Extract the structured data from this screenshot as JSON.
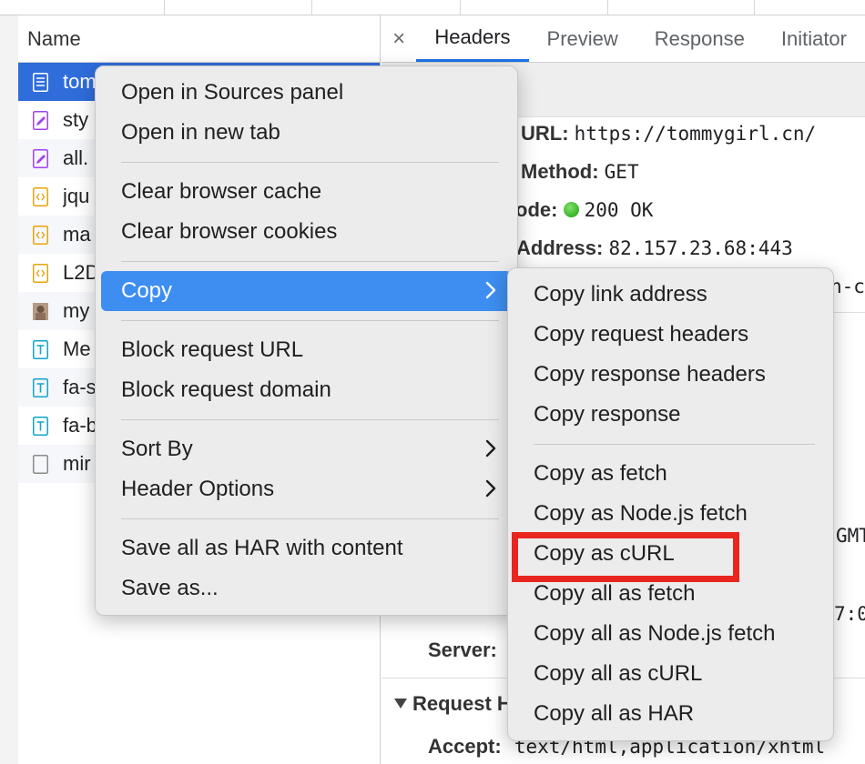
{
  "list": {
    "header": "Name",
    "rows": [
      {
        "name": "tom",
        "icon": "document-icon",
        "selected": true
      },
      {
        "name": "sty",
        "icon": "stylesheet-icon"
      },
      {
        "name": "all.",
        "icon": "stylesheet-icon"
      },
      {
        "name": "jqu",
        "icon": "script-icon"
      },
      {
        "name": "ma",
        "icon": "script-icon"
      },
      {
        "name": "L2D",
        "icon": "script-icon"
      },
      {
        "name": "my",
        "icon": "image-thumbnail-icon"
      },
      {
        "name": "Me",
        "icon": "font-icon"
      },
      {
        "name": "fa-s",
        "icon": "font-icon"
      },
      {
        "name": "fa-b",
        "icon": "font-icon"
      },
      {
        "name": "mir",
        "icon": "blank-file-icon"
      }
    ]
  },
  "details": {
    "close": "×",
    "tabs": [
      "Headers",
      "Preview",
      "Response",
      "Initiator"
    ],
    "url_key": "URL:",
    "url_val": "https://tommygirl.cn/",
    "method_key": "Method:",
    "method_val": "GET",
    "status_key": "ode:",
    "status_val": "200 OK",
    "address_key": "Address:",
    "address_val": "82.157.23.68:443",
    "partial_1": "n-c",
    "partial_2": "GMT",
    "partial_3": "7:0",
    "server_key": "Server:",
    "request_section": "Request H",
    "accept_key": "Accept:",
    "accept_val": "text/html,application/xhtml"
  },
  "context_menu": {
    "items": [
      {
        "label": "Open in Sources panel"
      },
      {
        "label": "Open in new tab"
      },
      {
        "sep": true
      },
      {
        "label": "Clear browser cache"
      },
      {
        "label": "Clear browser cookies"
      },
      {
        "sep": true
      },
      {
        "label": "Copy",
        "submenu": true,
        "highlighted": true
      },
      {
        "sep": true
      },
      {
        "label": "Block request URL"
      },
      {
        "label": "Block request domain"
      },
      {
        "sep": true
      },
      {
        "label": "Sort By",
        "submenu": true
      },
      {
        "label": "Header Options",
        "submenu": true
      },
      {
        "sep": true
      },
      {
        "label": "Save all as HAR with content"
      },
      {
        "label": "Save as..."
      }
    ]
  },
  "copy_submenu": {
    "items": [
      {
        "label": "Copy link address"
      },
      {
        "label": "Copy request headers"
      },
      {
        "label": "Copy response headers"
      },
      {
        "label": "Copy response"
      },
      {
        "sep": true
      },
      {
        "label": "Copy as fetch"
      },
      {
        "label": "Copy as Node.js fetch"
      },
      {
        "label": "Copy as cURL",
        "annotated": true
      },
      {
        "label": "Copy all as fetch"
      },
      {
        "label": "Copy all as Node.js fetch"
      },
      {
        "label": "Copy all as cURL"
      },
      {
        "label": "Copy all as HAR"
      }
    ]
  },
  "colors": {
    "selection": "#2f6ddb",
    "menu_highlight": "#3d8ef0",
    "annotation": "#e8261f",
    "status_ok": "#1c9d12"
  }
}
